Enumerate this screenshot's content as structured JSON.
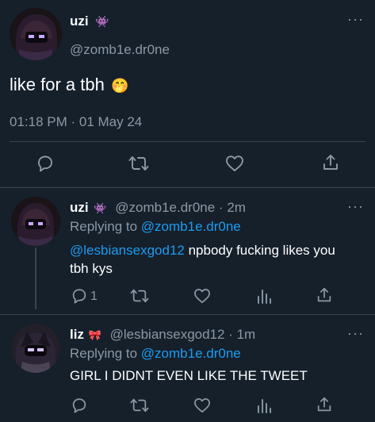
{
  "main_tweet": {
    "display_name": "uzi",
    "name_emoji": "👾",
    "handle": "@zomb1e.dr0ne",
    "text": "like for a tbh",
    "text_emoji": "🤭",
    "timestamp": "01:18 PM · 01 May 24",
    "more_label": "···"
  },
  "replies": [
    {
      "display_name": "uzi",
      "name_emoji": "👾",
      "handle_time": "@zomb1e.dr0ne · 2m",
      "replying_prefix": "Replying to",
      "replying_to": "@zomb1e.dr0ne",
      "mention": "@lesbiansexgod12",
      "text_line1": " npbody fucking likes you",
      "text_line2": "tbh kys",
      "reply_count": "1",
      "more_label": "···"
    },
    {
      "display_name": "liz",
      "name_emoji": "🎀",
      "handle_time": "@lesbiansexgod12 · 1m",
      "replying_prefix": "Replying to",
      "replying_to": "@zomb1e.dr0ne",
      "text": "GIRL I DIDNT EVEN LIKE THE TWEET",
      "more_label": "···"
    }
  ],
  "colors": {
    "background": "#15202b",
    "muted": "#8b98a5",
    "link": "#1d9bf0",
    "divider": "#38444d"
  },
  "icons": [
    "reply-icon",
    "retweet-icon",
    "like-icon",
    "share-icon",
    "stats-icon",
    "more-icon"
  ]
}
